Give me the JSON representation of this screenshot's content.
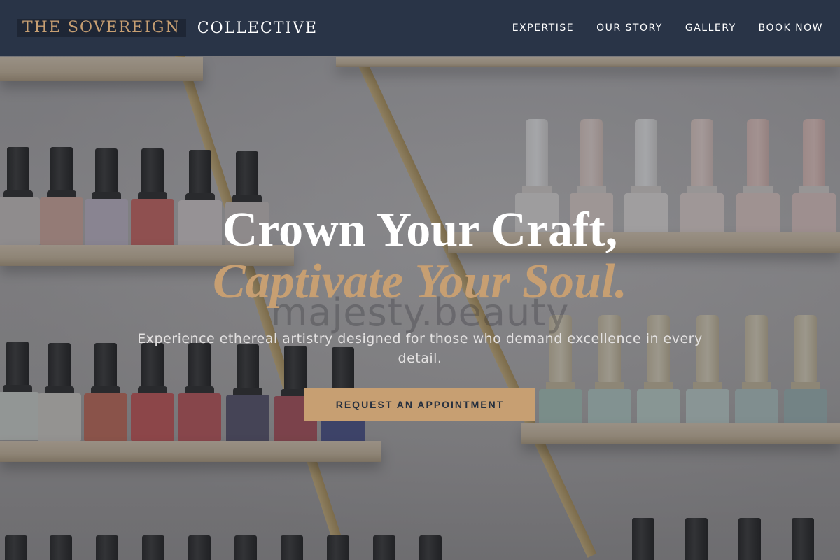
{
  "header": {
    "logo_accent": "THE SOVEREIGN",
    "logo_main": "COLLECTIVE",
    "nav": [
      {
        "label": "EXPERTISE"
      },
      {
        "label": "OUR STORY"
      },
      {
        "label": "GALLERY"
      },
      {
        "label": "BOOK NOW"
      }
    ]
  },
  "hero": {
    "headline": "Crown Your Craft,",
    "headline_accent": "Captivate Your Soul.",
    "subtitle": "Experience ethereal artistry designed for those who demand excellence in every detail.",
    "cta_label": "REQUEST AN APPOINTMENT",
    "watermark": "majesty.beauty"
  },
  "colors": {
    "header_bg": "#293447",
    "accent": "#c79f72",
    "text_light": "#ffffff"
  }
}
